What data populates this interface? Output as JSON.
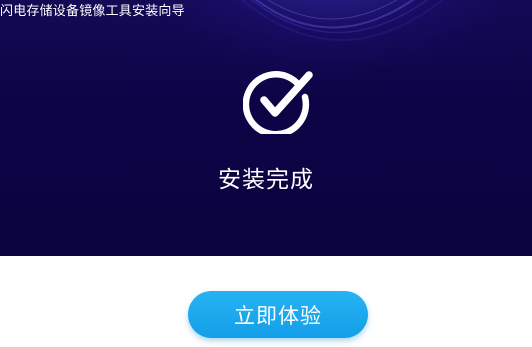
{
  "window": {
    "title": "闪电存储设备镜像工具安装向导"
  },
  "hero": {
    "status_icon": "check-circle-icon",
    "status_text": "安装完成"
  },
  "footer": {
    "action_label": "立即体验"
  },
  "colors": {
    "hero_background": "#0d0447",
    "accent": "#1aa6ee",
    "text_on_dark": "#ffffff"
  }
}
